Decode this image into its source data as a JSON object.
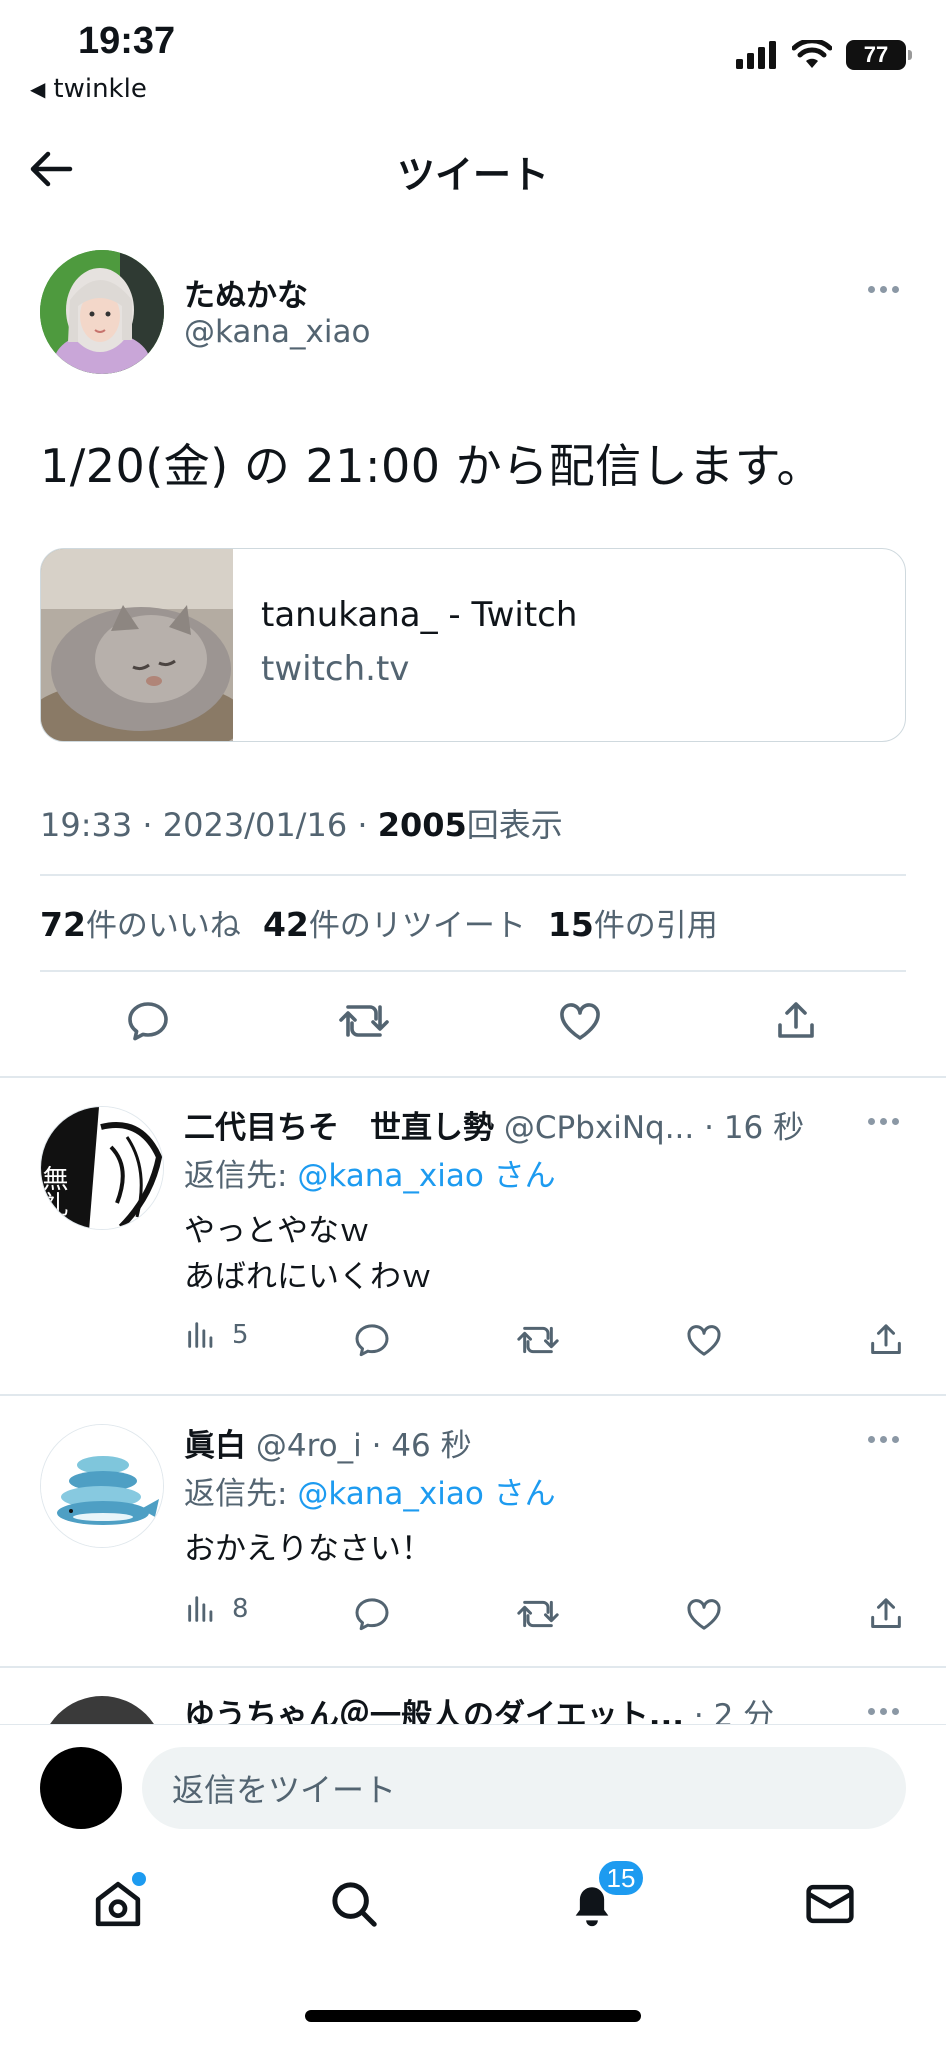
{
  "status_bar": {
    "time": "19:37",
    "back_app": "twinkle",
    "battery": "77"
  },
  "nav": {
    "title": "ツイート"
  },
  "tweet": {
    "author_name": "たぬかな",
    "author_handle": "@kana_xiao",
    "text": "1/20(金) の 21:00 から配信します。",
    "card": {
      "title": "tanukana_ - Twitch",
      "domain": "twitch.tv"
    },
    "time": "19:33 · 2023/01/16 · ",
    "views_count": "2005",
    "views_label": "回表示",
    "likes_count": "72",
    "likes_label": "件のいいね",
    "retweets_count": "42",
    "retweets_label": "件のリツイート",
    "quotes_count": "15",
    "quotes_label": "件の引用"
  },
  "replies": [
    {
      "name": "二代目ちそ　世直し勢",
      "meta": " @CPbxiNq... · 16 秒",
      "reply_to_prefix": "返信先: ",
      "reply_to_handle": "@kana_xiao さん",
      "body_line1": "やっとやなｗ",
      "body_line2": "あばれにいくわｗ",
      "views": "5",
      "avatar_text": "無礼"
    },
    {
      "name": "眞白",
      "meta": " @4ro_i · 46 秒",
      "reply_to_prefix": "返信先: ",
      "reply_to_handle": "@kana_xiao さん",
      "body_line1": "おかえりなさい！",
      "views": "8"
    },
    {
      "name": "ゆうちゃん＠一般人のダイエット...",
      "meta": " · 2 分"
    }
  ],
  "reply_bar": {
    "placeholder": "返信をツイート"
  },
  "tabbar": {
    "notifications_count": "15"
  },
  "colors": {
    "accent": "#1d9bf0",
    "muted": "#536471",
    "border": "#cfd9de"
  }
}
